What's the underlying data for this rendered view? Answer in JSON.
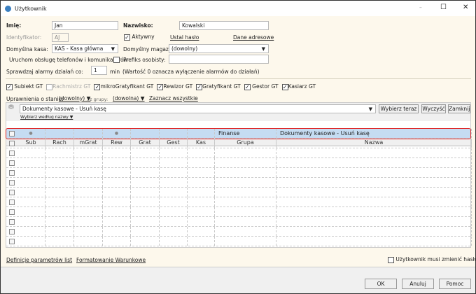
{
  "window": {
    "title": "Użytkownik",
    "minimize": "–",
    "maximize": "☐",
    "close": "✕"
  },
  "form": {
    "imie_label": "Imię:",
    "imie_value": "Jan",
    "nazwisko_label": "Nazwisko:",
    "nazwisko_value": "Kowalski",
    "identyfikator_label": "Identyfikator:",
    "identyfikator_value": "AJ",
    "aktywny_label": "Aktywny",
    "aktywny_checked": true,
    "ustal_haslo": "Ustal hasło",
    "dane_adresowe": "Dane adresowe",
    "kasa_label": "Domyślna kasa:",
    "kasa_value": "KAS - Kasa główna",
    "magazyn_label": "Domyślny magazyn:",
    "magazyn_value": "(dowolny)",
    "telefony_label": "Uruchom obsługę telefonów i komunikatorów",
    "telefony_checked": false,
    "prefiks_label": "Prefiks osobisty:",
    "prefiks_value": "",
    "alarmy_label": "Sprawdzaj alarmy działań co:",
    "alarmy_value": "1",
    "alarmy_unit": "min",
    "alarmy_note": "(Wartość 0 oznacza wyłączenie alarmów do działań)"
  },
  "apps": [
    {
      "label": "Subiekt GT",
      "checked": true,
      "enabled": true
    },
    {
      "label": "Rachmistrz GT",
      "checked": false,
      "enabled": false
    },
    {
      "label": "mikroGratyfikant GT",
      "checked": true,
      "enabled": true
    },
    {
      "label": "Rewizor GT",
      "checked": true,
      "enabled": true
    },
    {
      "label": "Gratyfikant GT",
      "checked": true,
      "enabled": true
    },
    {
      "label": "Gestor GT",
      "checked": true,
      "enabled": true
    },
    {
      "label": "Kasiarz GT",
      "checked": true,
      "enabled": true
    }
  ],
  "filters": {
    "state_label": "Uprawnienia o stanie:",
    "state_value": "(dowolny)",
    "group_label": ", z grupy:",
    "group_value": "(dowolna)",
    "select_all": "Zaznacz wszystkie"
  },
  "search": {
    "value": "Dokumenty kasowe - Usuń kasę",
    "by_name": "Wybierz według nazwy",
    "choose_now": "Wybierz teraz",
    "clear": "Wyczyść",
    "close": "Zamknij"
  },
  "grid": {
    "columns": [
      "Sub",
      "Rach",
      "mGrat",
      "Rew",
      "Grat",
      "Gest",
      "Kas",
      "Grupa",
      "Nazwa"
    ],
    "rows": [
      {
        "checked": false,
        "marks": [
          true,
          false,
          false,
          true,
          false,
          false,
          false
        ],
        "grupa": "Finanse",
        "nazwa": "Dokumenty kasowe - Usuń kasę",
        "selected": true
      }
    ],
    "empty_rows": 11
  },
  "footer": {
    "definicje": "Definicje parametrów list",
    "formatowanie": "Formatowanie Warunkowe",
    "must_change": "Użytkownik musi zmienić hasło",
    "must_change_checked": false
  },
  "buttons": {
    "ok": "OK",
    "cancel": "Anuluj",
    "help": "Pomoc"
  },
  "colors": {
    "selected_row": "#c5dcf2",
    "highlight_border": "#e02020",
    "panel_bg": "#fdf8ec"
  }
}
